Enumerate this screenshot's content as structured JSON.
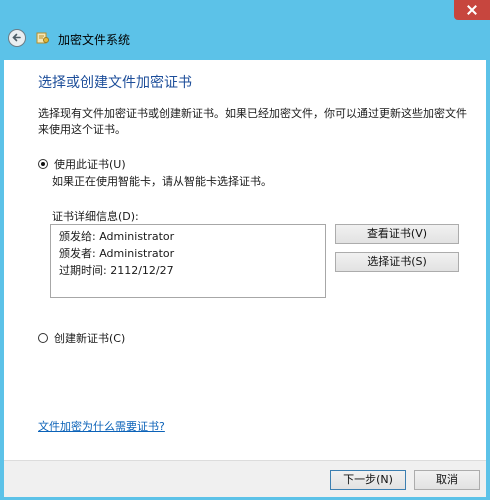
{
  "window": {
    "title": "加密文件系统"
  },
  "page": {
    "heading": "选择或创建文件加密证书",
    "description": "选择现有文件加密证书或创建新证书。如果已经加密文件，你可以通过更新这些加密文件来使用这个证书。"
  },
  "option_use": {
    "label": "使用此证书(U)",
    "hint": "如果正在使用智能卡，请从智能卡选择证书。",
    "checked": true
  },
  "details": {
    "label": "证书详细信息(D):",
    "issued_to": "颁发给: Administrator",
    "issued_by": "颁发者: Administrator",
    "expires": "过期时间: 2112/12/27"
  },
  "buttons": {
    "view_cert": "查看证书(V)",
    "select_cert": "选择证书(S)",
    "next": "下一步(N)",
    "cancel": "取消"
  },
  "option_new": {
    "label": "创建新证书(C)",
    "checked": false
  },
  "help_link": "文件加密为什么需要证书?",
  "colors": {
    "frame": "#5cc2e8",
    "heading": "#1d4e9a",
    "link": "#0b62b8",
    "close": "#c7463e"
  },
  "icons": {
    "back": "back-arrow-icon",
    "app": "certificate-key-icon",
    "close": "close-icon"
  }
}
